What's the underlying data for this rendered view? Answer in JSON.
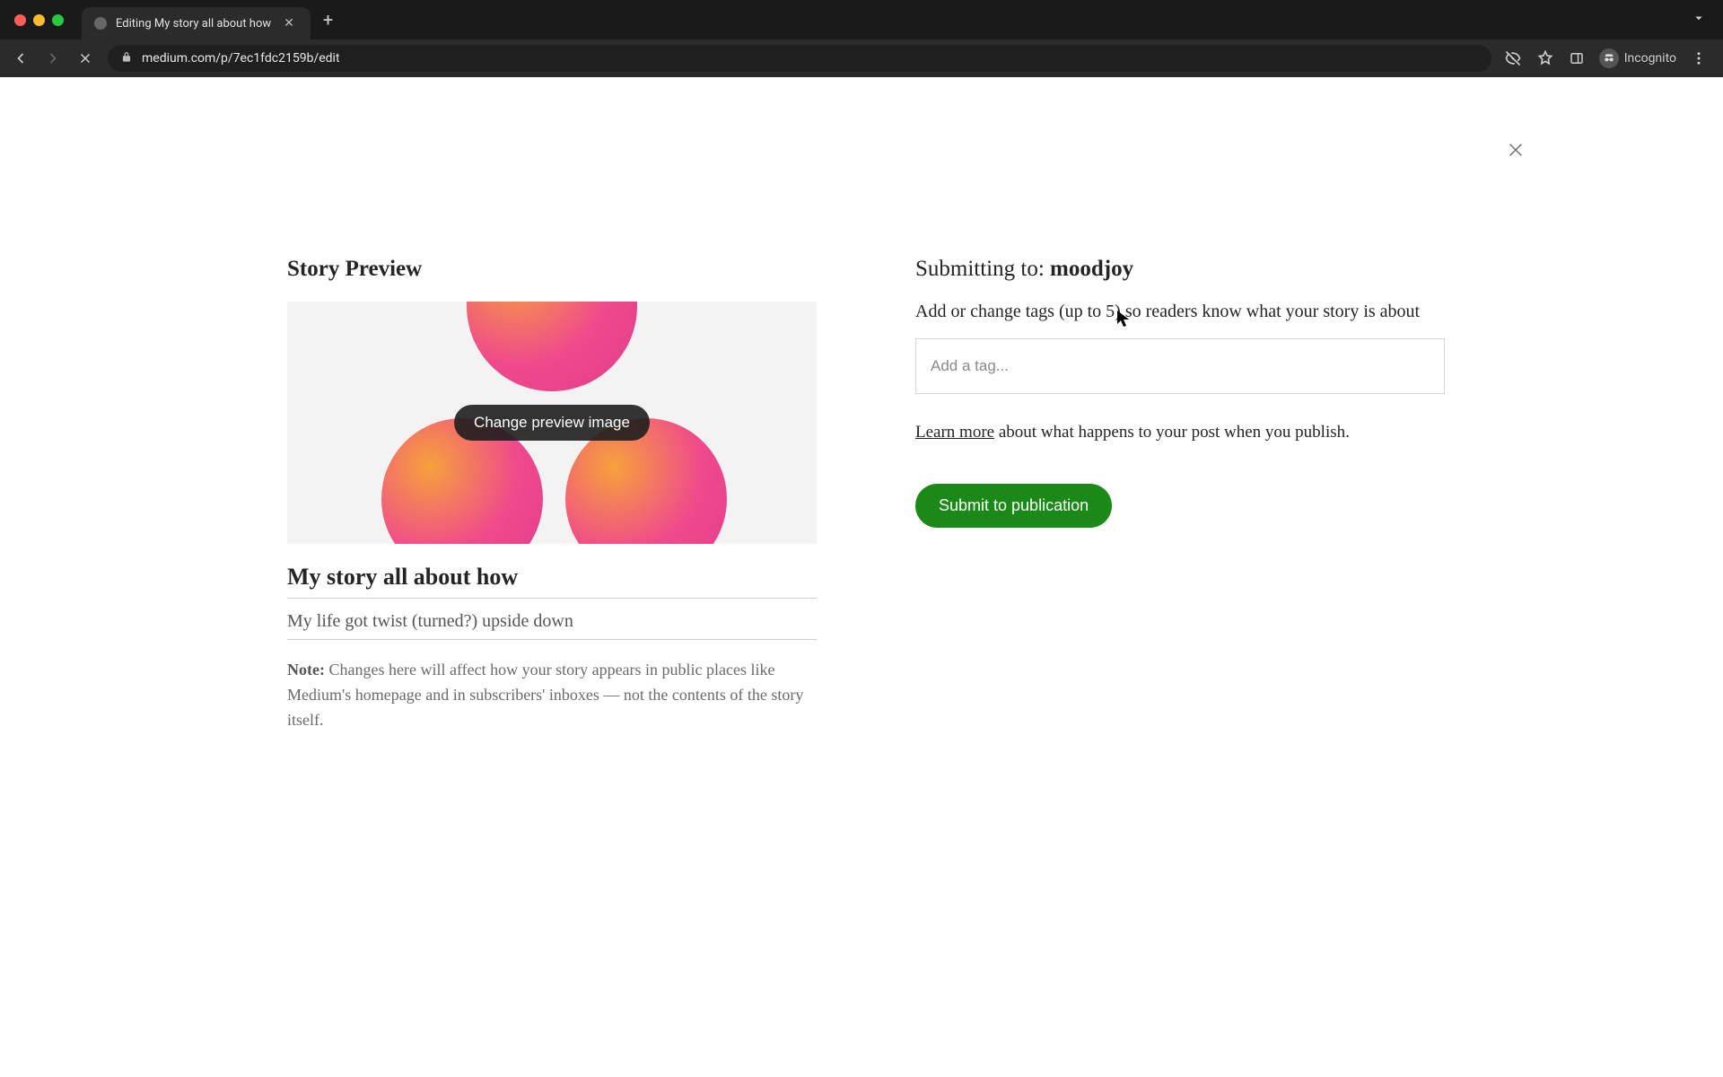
{
  "browser": {
    "tab_title": "Editing My story all about how",
    "url": "medium.com/p/7ec1fdc2159b/edit",
    "incognito_label": "Incognito"
  },
  "close_icon": "×",
  "left": {
    "heading": "Story Preview",
    "change_image_label": "Change preview image",
    "title_value": "My story all about how",
    "subtitle_value": "My life got twist (turned?) upside down",
    "note_label": "Note:",
    "note_text": " Changes here will affect how your story appears in public places like Medium's homepage and in subscribers' inboxes — not the contents of the story itself."
  },
  "right": {
    "submitting_label": "Submitting to: ",
    "publication": "moodjoy",
    "tags_hint": "Add or change tags (up to 5) so readers know what your story is about",
    "tag_placeholder": "Add a tag...",
    "learn_more": "Learn more",
    "learn_rest": " about what happens to your post when you publish.",
    "submit_label": "Submit to publication"
  }
}
